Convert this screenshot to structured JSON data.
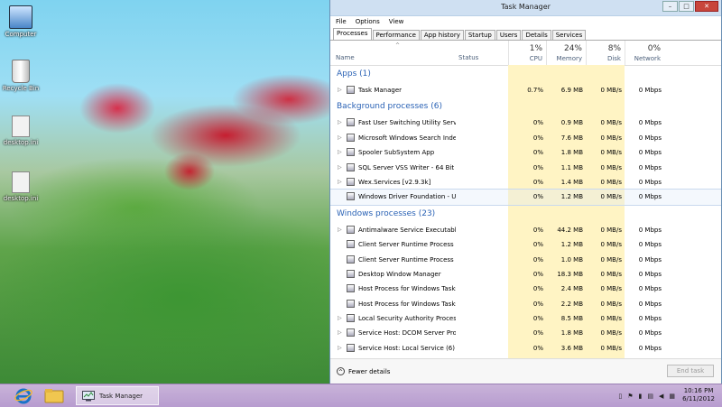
{
  "desktop": {
    "icons": [
      {
        "label": "Computer",
        "icon": "computer-icon"
      },
      {
        "label": "Recycle Bin",
        "icon": "recycle-bin-icon"
      },
      {
        "label": "desktop.ini",
        "icon": "file-icon"
      },
      {
        "label": "desktop.ini",
        "icon": "file-icon"
      }
    ]
  },
  "window": {
    "title": "Task Manager",
    "controls": {
      "minimize": "–",
      "maximize": "□",
      "close": "✕"
    }
  },
  "menu": [
    "File",
    "Options",
    "View"
  ],
  "tabs": [
    "Processes",
    "Performance",
    "App history",
    "Startup",
    "Users",
    "Details",
    "Services"
  ],
  "active_tab": "Processes",
  "columns": {
    "name": "Name",
    "status": "Status",
    "cpu": {
      "pct": "1%",
      "label": "CPU"
    },
    "memory": {
      "pct": "24%",
      "label": "Memory"
    },
    "disk": {
      "pct": "8%",
      "label": "Disk"
    },
    "network": {
      "pct": "0%",
      "label": "Network"
    }
  },
  "groups": [
    {
      "title": "Apps (1)",
      "rows": [
        {
          "name": "Task Manager",
          "cpu": "0.7%",
          "mem": "6.9 MB",
          "disk": "0 MB/s",
          "net": "0 Mbps",
          "expandable": true
        }
      ]
    },
    {
      "title": "Background processes (6)",
      "rows": [
        {
          "name": "Fast User Switching Utility Service",
          "cpu": "0%",
          "mem": "0.9 MB",
          "disk": "0 MB/s",
          "net": "0 Mbps",
          "expandable": true
        },
        {
          "name": "Microsoft Windows Search Inde...",
          "cpu": "0%",
          "mem": "7.6 MB",
          "disk": "0 MB/s",
          "net": "0 Mbps",
          "expandable": true
        },
        {
          "name": "Spooler SubSystem App",
          "cpu": "0%",
          "mem": "1.8 MB",
          "disk": "0 MB/s",
          "net": "0 Mbps",
          "expandable": true
        },
        {
          "name": "SQL Server VSS Writer - 64 Bit",
          "cpu": "0%",
          "mem": "1.1 MB",
          "disk": "0 MB/s",
          "net": "0 Mbps",
          "expandable": true
        },
        {
          "name": "Wex.Services [v2.9.3k]",
          "cpu": "0%",
          "mem": "1.4 MB",
          "disk": "0 MB/s",
          "net": "0 Mbps",
          "expandable": true
        },
        {
          "name": "Windows Driver Foundation - U...",
          "cpu": "0%",
          "mem": "1.2 MB",
          "disk": "0 MB/s",
          "net": "0 Mbps",
          "expandable": false,
          "selected": true
        }
      ]
    },
    {
      "title": "Windows processes (23)",
      "rows": [
        {
          "name": "Antimalware Service Executable",
          "cpu": "0%",
          "mem": "44.2 MB",
          "disk": "0 MB/s",
          "net": "0 Mbps",
          "expandable": true
        },
        {
          "name": "Client Server Runtime Process",
          "cpu": "0%",
          "mem": "1.2 MB",
          "disk": "0 MB/s",
          "net": "0 Mbps",
          "expandable": false
        },
        {
          "name": "Client Server Runtime Process",
          "cpu": "0%",
          "mem": "1.0 MB",
          "disk": "0 MB/s",
          "net": "0 Mbps",
          "expandable": false
        },
        {
          "name": "Desktop Window Manager",
          "cpu": "0%",
          "mem": "18.3 MB",
          "disk": "0 MB/s",
          "net": "0 Mbps",
          "expandable": false
        },
        {
          "name": "Host Process for Windows Tasks",
          "cpu": "0%",
          "mem": "2.4 MB",
          "disk": "0 MB/s",
          "net": "0 Mbps",
          "expandable": false
        },
        {
          "name": "Host Process for Windows Tasks",
          "cpu": "0%",
          "mem": "2.2 MB",
          "disk": "0 MB/s",
          "net": "0 Mbps",
          "expandable": false
        },
        {
          "name": "Local Security Authority Process",
          "cpu": "0%",
          "mem": "8.5 MB",
          "disk": "0 MB/s",
          "net": "0 Mbps",
          "expandable": true
        },
        {
          "name": "Service Host: DCOM Server Proc...",
          "cpu": "0%",
          "mem": "1.8 MB",
          "disk": "0 MB/s",
          "net": "0 Mbps",
          "expandable": true
        },
        {
          "name": "Service Host: Local Service (6)",
          "cpu": "0%",
          "mem": "3.6 MB",
          "disk": "0 MB/s",
          "net": "0 Mbps",
          "expandable": true
        }
      ]
    }
  ],
  "footer": {
    "fewer_details": "Fewer details",
    "end_task": "End task"
  },
  "taskbar": {
    "task_manager_label": "Task Manager",
    "time": "10:16 PM",
    "date": "6/11/2012"
  },
  "colors": {
    "accent": "#2a62b5",
    "heat": "#fff4c4",
    "taskbar": "#c9b3d9"
  }
}
